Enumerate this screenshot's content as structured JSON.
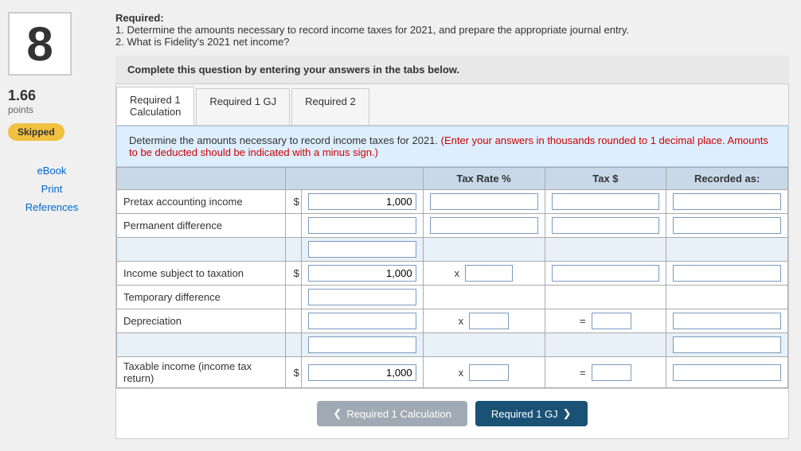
{
  "sidebar": {
    "problem_number": "8",
    "points_value": "1.66",
    "points_label": "points",
    "status": "Skipped",
    "links": [
      "eBook",
      "Print",
      "References"
    ]
  },
  "header": {
    "required_label": "Required:",
    "instruction_1": "1. Determine the amounts necessary to record income taxes for 2021, and prepare the appropriate journal entry.",
    "instruction_2": "2. What is Fidelity's 2021 net income?"
  },
  "instruction_box": "Complete this question by entering your answers in the tabs below.",
  "tabs": [
    {
      "id": "req1calc",
      "label": "Required 1 Calculation",
      "active": true
    },
    {
      "id": "req1gj",
      "label": "Required 1 GJ",
      "active": false
    },
    {
      "id": "req2",
      "label": "Required 2",
      "active": false
    }
  ],
  "description": {
    "main": "Determine the amounts necessary to record income taxes for 2021.",
    "note": "(Enter your answers in thousands rounded to 1 decimal place. Amounts to be deducted should be indicated with a minus sign.)"
  },
  "table": {
    "headers": [
      "",
      "",
      "",
      "Tax Rate %",
      "Tax $",
      "Recorded as:"
    ],
    "rows": [
      {
        "label": "Pretax accounting income",
        "dollar": "$",
        "amount": "1,000",
        "symbol": "",
        "tax_rate": "",
        "tax_dollar": "",
        "recorded": ""
      },
      {
        "label": "Permanent difference",
        "dollar": "",
        "amount": "",
        "symbol": "",
        "tax_rate": "",
        "tax_dollar": "",
        "recorded": ""
      },
      {
        "label": "",
        "dollar": "",
        "amount": "",
        "symbol": "",
        "tax_rate": "",
        "tax_dollar": "",
        "recorded": ""
      },
      {
        "label": "Income subject to taxation",
        "dollar": "$",
        "amount": "1,000",
        "symbol": "x",
        "tax_rate": "",
        "tax_dollar": "",
        "recorded": ""
      },
      {
        "label": "Temporary difference",
        "dollar": "",
        "amount": "",
        "symbol": "",
        "tax_rate": "",
        "tax_dollar": "",
        "recorded": ""
      },
      {
        "label": "Depreciation",
        "dollar": "",
        "amount": "",
        "symbol": "x",
        "tax_rate": "",
        "equals": "=",
        "recorded": ""
      },
      {
        "label": "",
        "dollar": "",
        "amount": "",
        "symbol": "",
        "tax_rate": "",
        "tax_dollar": "",
        "recorded": ""
      },
      {
        "label": "Taxable income (income tax return)",
        "dollar": "$",
        "amount": "1,000",
        "symbol": "x",
        "tax_rate": "",
        "equals": "=",
        "recorded": ""
      }
    ]
  },
  "bottom_nav": {
    "prev_label": "Required 1 Calculation",
    "next_label": "Required 1 GJ"
  }
}
